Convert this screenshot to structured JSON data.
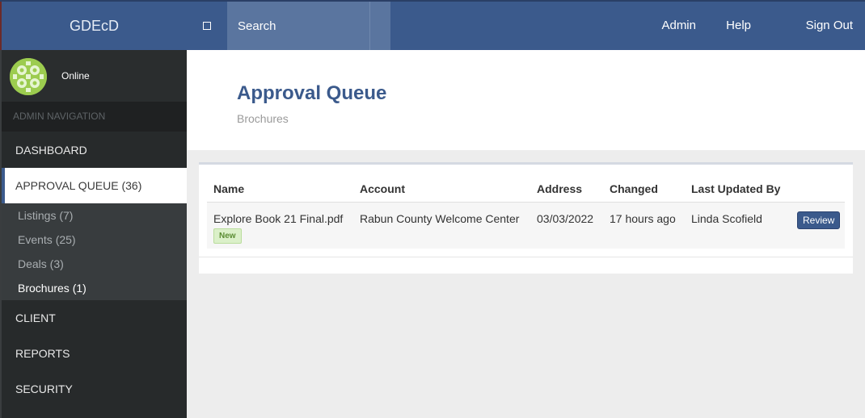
{
  "header": {
    "brand": "GDEcD",
    "search_placeholder": "Search",
    "nav": {
      "admin": "Admin",
      "help": "Help",
      "sign_out": "Sign Out"
    }
  },
  "sidebar": {
    "user_status": "Online",
    "section_heading": "ADMIN NAVIGATION",
    "items": {
      "dashboard": "DASHBOARD",
      "approval_queue": "APPROVAL QUEUE (36)",
      "client": "CLIENT",
      "reports": "REPORTS",
      "security": "SECURITY"
    },
    "subitems": {
      "listings": "Listings (7)",
      "events": "Events (25)",
      "deals": "Deals (3)",
      "brochures": "Brochures (1)"
    }
  },
  "main": {
    "title": "Approval Queue",
    "subtitle": "Brochures",
    "table": {
      "columns": [
        "Name",
        "Account",
        "Address",
        "Changed",
        "Last Updated By"
      ],
      "rows": [
        {
          "name": "Explore Book 21 Final.pdf",
          "badge": "New",
          "account": "Rabun County Welcome Center",
          "address": "03/03/2022",
          "changed": "17 hours ago",
          "updated_by": "Linda Scofield",
          "action": "Review"
        }
      ]
    }
  },
  "colors": {
    "primary": "#3b5a8c",
    "sidebar_bg": "#272a2b",
    "badge_bg": "#dbf0c9"
  }
}
